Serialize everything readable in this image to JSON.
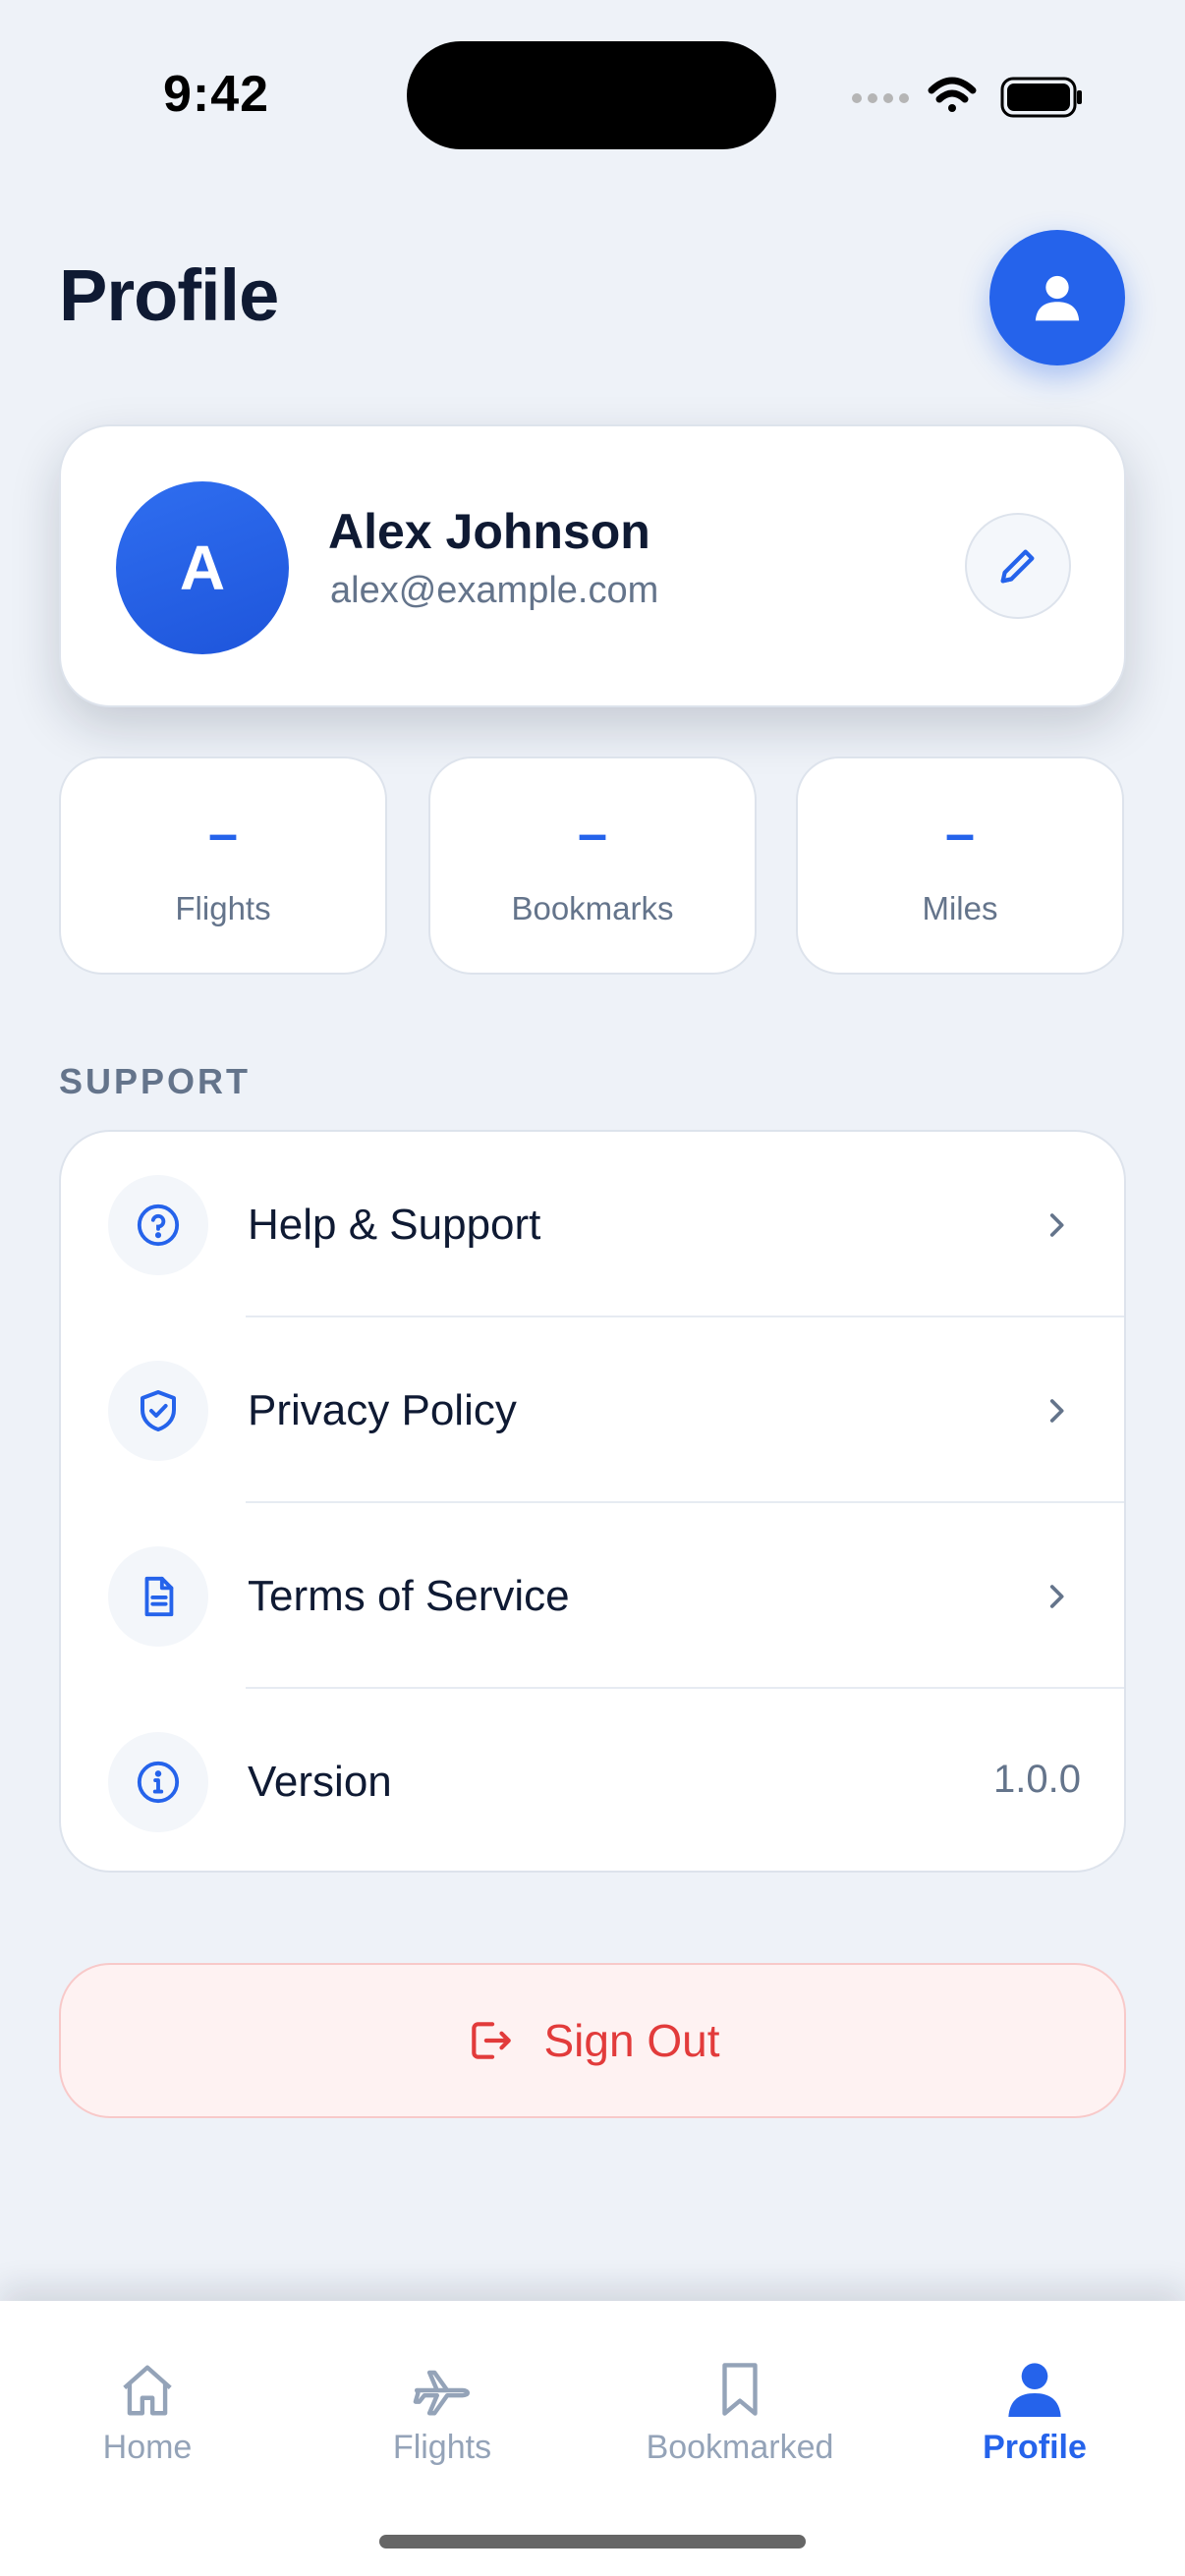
{
  "status_bar": {
    "time": "9:42"
  },
  "header": {
    "title": "Profile"
  },
  "profile": {
    "initial": "A",
    "name": "Alex Johnson",
    "email": "alex@example.com"
  },
  "stats": [
    {
      "value": "–",
      "label": "Flights"
    },
    {
      "value": "–",
      "label": "Bookmarks"
    },
    {
      "value": "–",
      "label": "Miles"
    }
  ],
  "support": {
    "section_title": "SUPPORT",
    "items": [
      {
        "label": "Help & Support",
        "icon": "help-circle-icon"
      },
      {
        "label": "Privacy Policy",
        "icon": "shield-check-icon"
      },
      {
        "label": "Terms of Service",
        "icon": "document-icon"
      },
      {
        "label": "Version",
        "icon": "info-icon",
        "value": "1.0.0"
      }
    ]
  },
  "sign_out": {
    "label": "Sign Out",
    "color": "#E23B3B"
  },
  "tabs": [
    {
      "label": "Home",
      "icon": "home-icon"
    },
    {
      "label": "Flights",
      "icon": "airplane-icon"
    },
    {
      "label": "Bookmarked",
      "icon": "bookmark-icon"
    },
    {
      "label": "Profile",
      "icon": "person-icon",
      "active": true
    }
  ],
  "colors": {
    "accent": "#2563EB",
    "background": "#EEF2F8",
    "danger": "#E23B3B"
  }
}
